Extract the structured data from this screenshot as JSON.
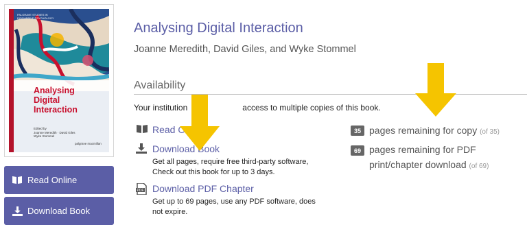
{
  "cover": {
    "series": "Palgrave Studies in Discursive Psychology",
    "title": "Analysing Digital Interaction",
    "editors_label": "Edited by",
    "editors": "Joanne Meredith · David Giles",
    "editors2": "Wyke Stommel",
    "publisher": "palgrave macmillan"
  },
  "sidebar": {
    "read_online_label": "Read Online",
    "download_book_label": "Download Book"
  },
  "book": {
    "title": "Analysing Digital Interaction",
    "authors": "Joanne Meredith, David Giles, and Wyke Stommel"
  },
  "availability": {
    "heading": "Availability",
    "text_prefix": "Your institution",
    "text_suffix": "access to multiple copies of this book."
  },
  "options": {
    "read_online": {
      "label": "Read O"
    },
    "download_book": {
      "label": "Download Book",
      "desc": "Get all pages, require free third-party software, Check out this book for up to 3 days."
    },
    "download_pdf": {
      "label": "Download PDF Chapter",
      "desc": "Get up to 69 pages, use any PDF software, does not expire."
    }
  },
  "counters": {
    "copy": {
      "count": "35",
      "text": "pages remaining for copy",
      "of": "(of 35)"
    },
    "pdf": {
      "count": "69",
      "text_line1": "pages remaining for PDF",
      "text_line2": "print/chapter download",
      "of": "(of 69)"
    }
  },
  "colors": {
    "accent": "#5b5ea6",
    "arrow": "#f5c400",
    "badge": "#666666"
  }
}
